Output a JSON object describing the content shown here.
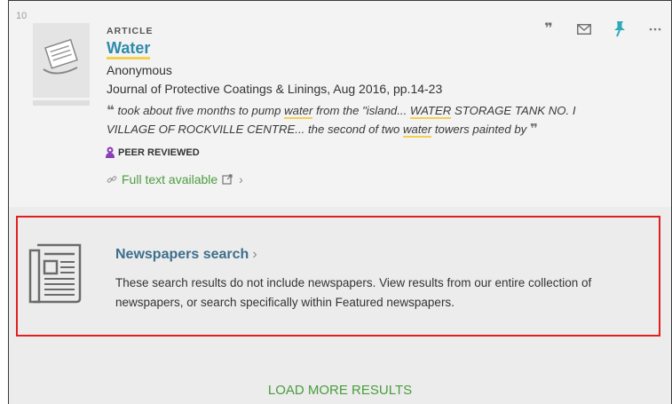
{
  "result": {
    "number": "10",
    "type": "ARTICLE",
    "title": "Water",
    "author": "Anonymous",
    "source": "Journal of Protective Coatings & Linings, Aug 2016, pp.14-23",
    "snippet": {
      "part1": "took about five months to pump ",
      "hl1": "water",
      "part2": " from the \"island... ",
      "hl2": "WATER",
      "part3": " STORAGE TANK NO. I VILLAGE OF ROCKVILLE CENTRE... the second of two ",
      "hl3": "water",
      "part4": " towers painted by"
    },
    "peer_reviewed": "PEER REVIEWED",
    "full_text": "Full text available",
    "actions": {
      "cite_icon": "quote-icon",
      "email_icon": "envelope-icon",
      "pin_icon": "pin-icon",
      "more_icon": "more-icon"
    }
  },
  "newspapers": {
    "title": "Newspapers search",
    "description": "These search results do not include newspapers. View results from our entire collection of newspapers, or search specifically within Featured newspapers."
  },
  "load_more": "LOAD MORE RESULTS",
  "colors": {
    "link": "#2f8bab",
    "green": "#4b9c3e",
    "highlight": "#f4d04f",
    "focus_border": "#e02020",
    "pin": "#2fa9b8",
    "peer_badge": "#8b3fb8"
  }
}
